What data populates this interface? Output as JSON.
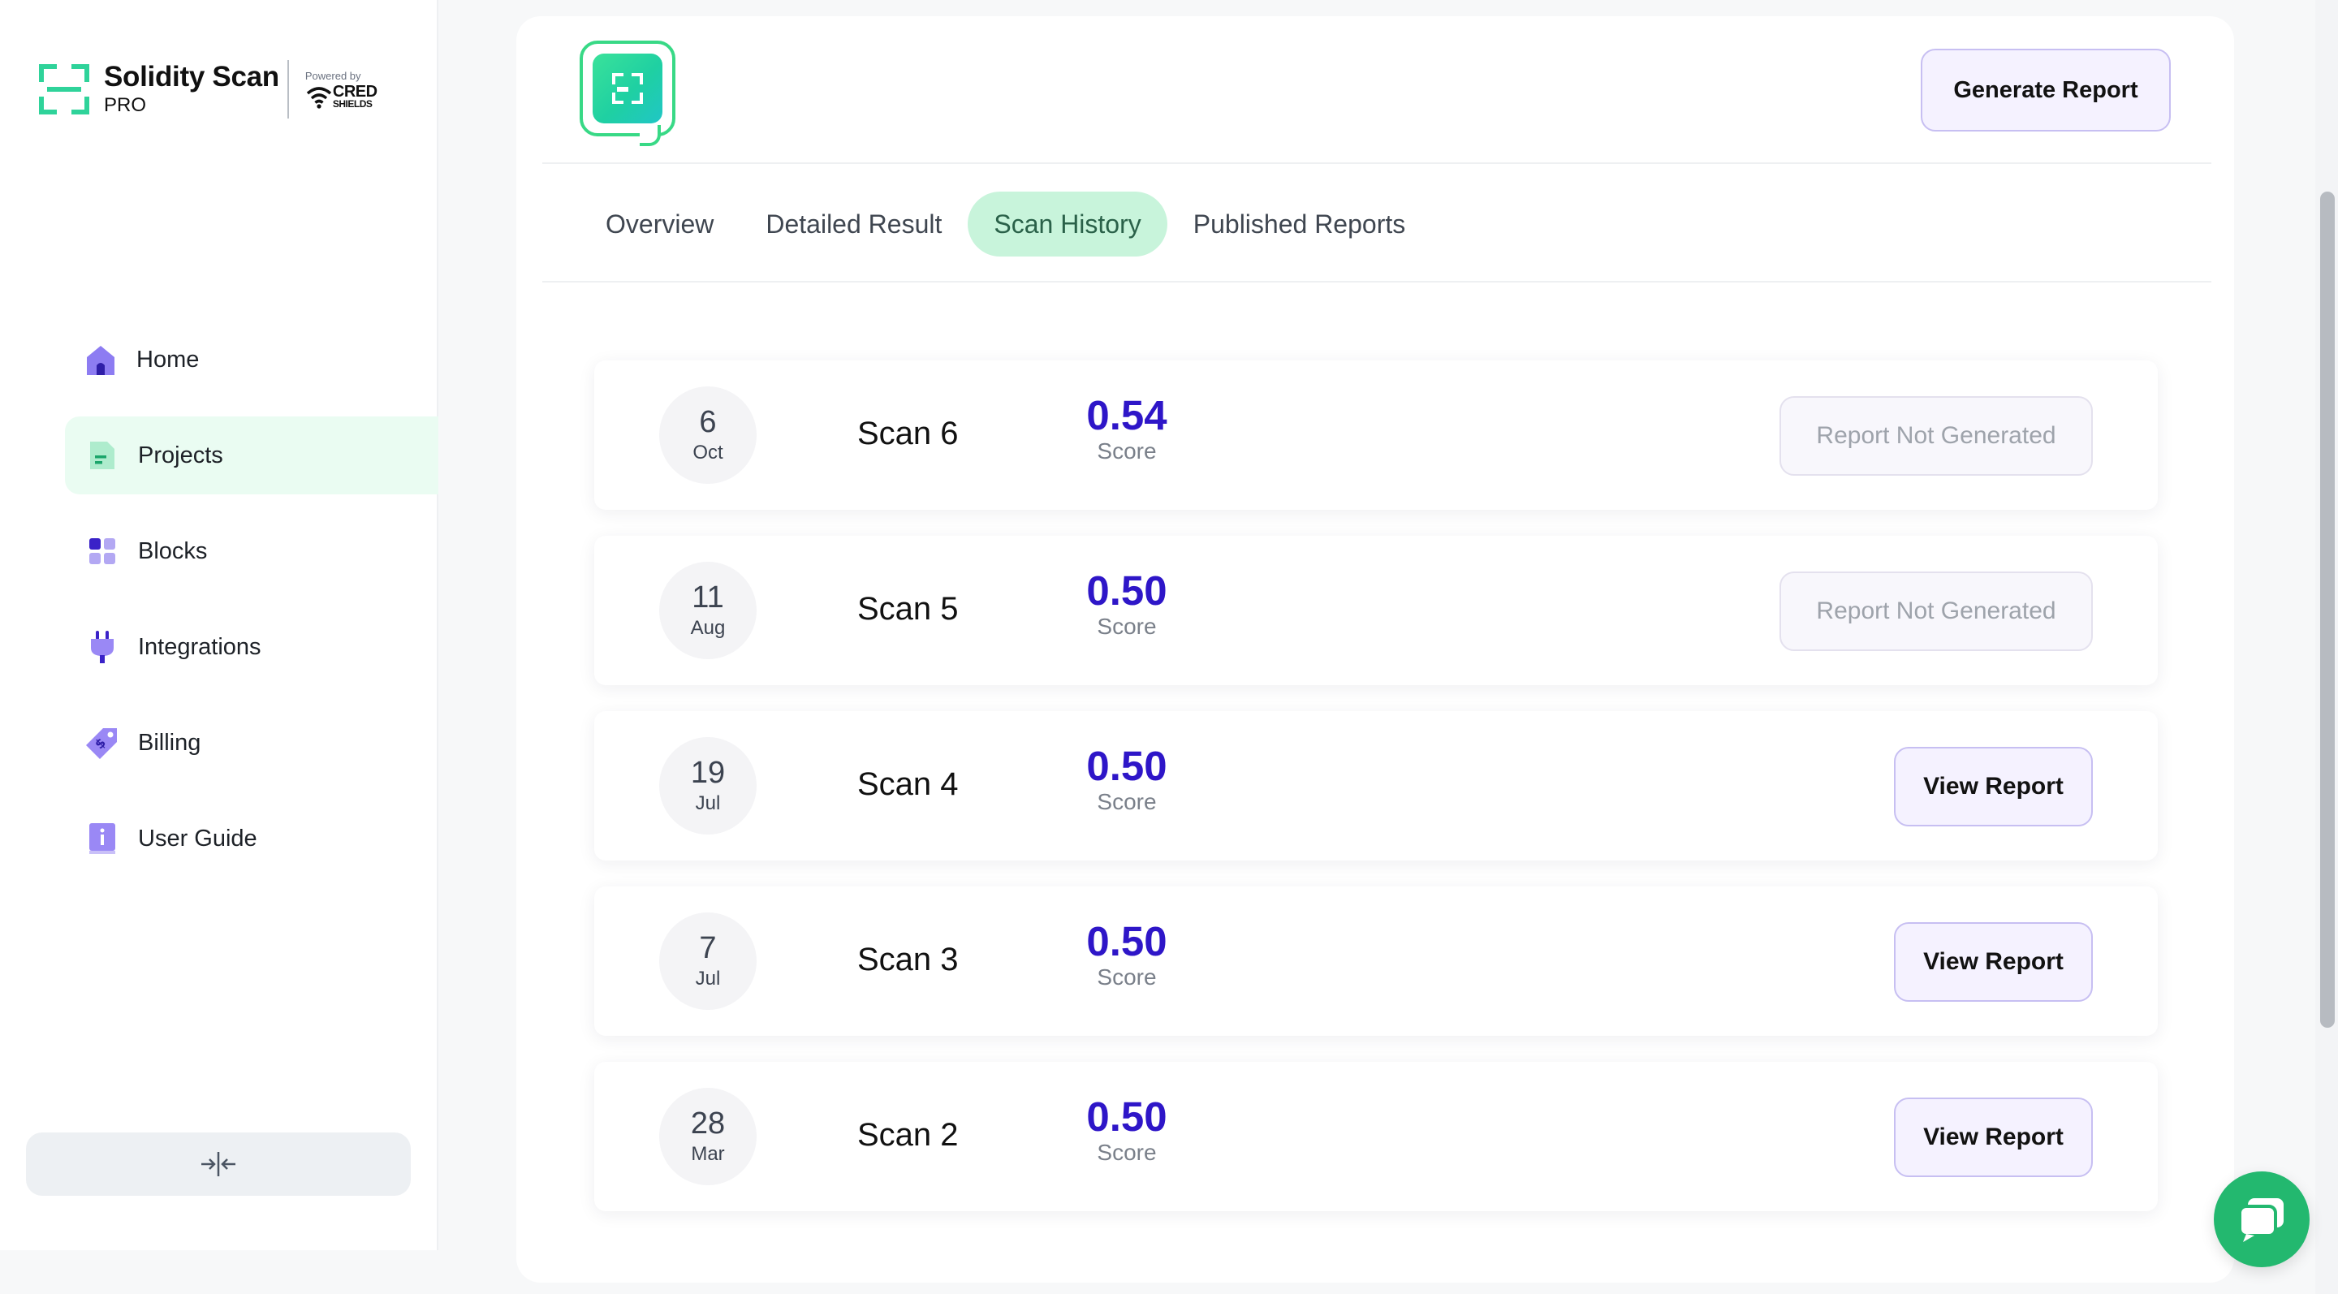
{
  "brand": {
    "name": "Solidity Scan",
    "tier": "PRO",
    "powered_by": "Powered by",
    "partner_line1": "CRED",
    "partner_line2": "SHIELDS"
  },
  "sidebar": {
    "items": [
      {
        "label": "Home",
        "icon": "home-icon",
        "active": false
      },
      {
        "label": "Projects",
        "icon": "document-icon",
        "active": true
      },
      {
        "label": "Blocks",
        "icon": "blocks-icon",
        "active": false
      },
      {
        "label": "Integrations",
        "icon": "plug-icon",
        "active": false
      },
      {
        "label": "Billing",
        "icon": "price-tag-icon",
        "active": false
      },
      {
        "label": "User Guide",
        "icon": "book-icon",
        "active": false
      }
    ],
    "collapse_icon": "collapse-icon"
  },
  "header": {
    "generate_label": "Generate Report"
  },
  "tabs": [
    {
      "label": "Overview",
      "active": false
    },
    {
      "label": "Detailed Result",
      "active": false
    },
    {
      "label": "Scan History",
      "active": true
    },
    {
      "label": "Published Reports",
      "active": false
    }
  ],
  "scans": [
    {
      "day": "6",
      "month": "Oct",
      "name": "Scan 6",
      "score": "0.54",
      "score_label": "Score",
      "action": "Report Not Generated",
      "action_enabled": false
    },
    {
      "day": "11",
      "month": "Aug",
      "name": "Scan 5",
      "score": "0.50",
      "score_label": "Score",
      "action": "Report Not Generated",
      "action_enabled": false
    },
    {
      "day": "19",
      "month": "Jul",
      "name": "Scan 4",
      "score": "0.50",
      "score_label": "Score",
      "action": "View Report",
      "action_enabled": true
    },
    {
      "day": "7",
      "month": "Jul",
      "name": "Scan 3",
      "score": "0.50",
      "score_label": "Score",
      "action": "View Report",
      "action_enabled": true
    },
    {
      "day": "28",
      "month": "Mar",
      "name": "Scan 2",
      "score": "0.50",
      "score_label": "Score",
      "action": "View Report",
      "action_enabled": true
    }
  ],
  "colors": {
    "accent_green": "#2fd39a",
    "active_tab_bg": "#c8f4db",
    "score_blue": "#2e16c8",
    "button_border": "#c7bff2",
    "chat_green": "#23b86f"
  },
  "chat": {
    "icon": "chat-bubble-icon"
  }
}
